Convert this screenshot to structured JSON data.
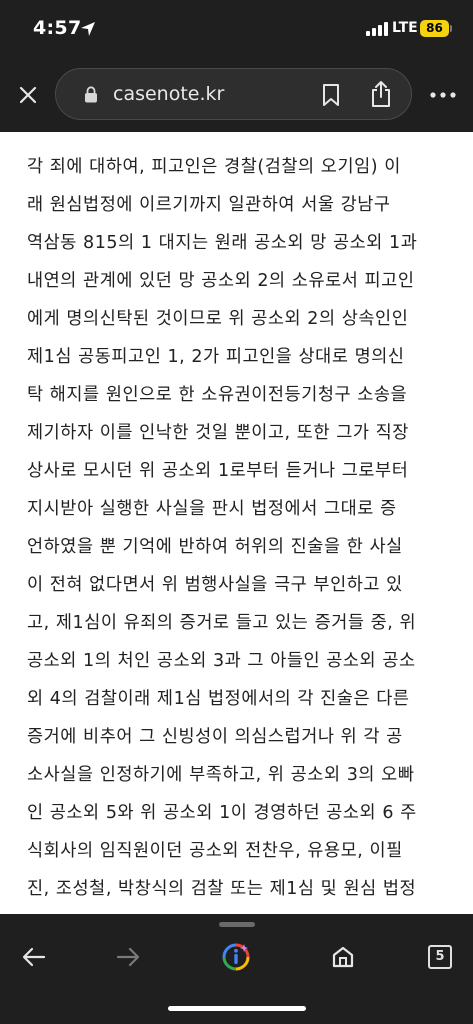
{
  "status_bar": {
    "time": "4:57",
    "network": "LTE",
    "battery": "86",
    "icons": [
      "location-arrow-icon",
      "signal-bars-icon",
      "battery-icon"
    ]
  },
  "address_bar": {
    "url": "casenote.kr",
    "icons": [
      "close-icon",
      "lock-icon",
      "bookmark-icon",
      "share-icon",
      "more-icon"
    ]
  },
  "article": {
    "lines": [
      "각 죄에 대하여, 피고인은 경찰(검찰의 오기임) 이",
      "래 원심법정에 이르기까지 일관하여 서울 강남구",
      "역삼동 815의 1 대지는 원래 공소외 망 공소외 1과",
      "내연의 관계에 있던 망 공소외 2의 소유로서 피고인",
      "에게 명의신탁된 것이므로 위 공소외 2의 상속인인",
      "제1심 공동피고인 1, 2가 피고인을 상대로 명의신",
      "탁 해지를 원인으로 한 소유권이전등기청구 소송을",
      "제기하자 이를 인낙한 것일 뿐이고, 또한 그가 직장",
      "상사로 모시던 위 공소외 1로부터 듣거나 그로부터",
      "지시받아 실행한 사실을 판시 법정에서 그대로 증",
      "언하였을 뿐 기억에 반하여 허위의 진술을 한 사실",
      "이 전혀 없다면서 위 범행사실을 극구 부인하고 있",
      "고, 제1심이 유죄의 증거로 들고 있는 증거들 중, 위",
      "공소외 1의 처인 공소외 3과 그 아들인 공소외 공소",
      "외 4의 검찰이래 제1심 법정에서의 각 진술은 다른",
      "증거에 비추어 그 신빙성이 의심스럽거나 위 각 공",
      "소사실을 인정하기에 부족하고, 위 공소외 3의 오빠",
      "인 공소외 5와 위 공소외 1이 경영하던 공소외 6 주",
      "식회사의 임직원이던 공소외 전찬우, 유용모, 이필",
      "진, 조성철, 박창식의 검찰 또는 제1심 및 원심 법정"
    ]
  },
  "bottom_toolbar": {
    "tab_count": "5",
    "icons": [
      "back-arrow-icon",
      "forward-arrow-icon",
      "google-lens-icon",
      "home-icon",
      "tabs-icon"
    ]
  },
  "colors": {
    "chrome_background": "#1f1f1f",
    "battery": "#f4d20f",
    "text": "#222222"
  }
}
